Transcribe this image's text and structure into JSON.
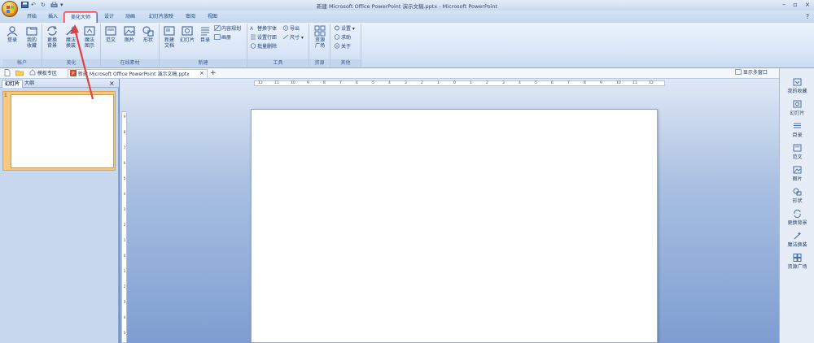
{
  "window": {
    "title": "新建 Microsoft Office PowerPoint 演示文稿.pptx - Microsoft PowerPoint"
  },
  "tabs": [
    {
      "label": "开始"
    },
    {
      "label": "插入"
    },
    {
      "label": "美化大师",
      "active": true
    },
    {
      "label": "设计"
    },
    {
      "label": "动画"
    },
    {
      "label": "幻灯片放映"
    },
    {
      "label": "审阅"
    },
    {
      "label": "视图"
    }
  ],
  "ribbon": {
    "account": {
      "label": "帐户",
      "login": "登录",
      "favorites": [
        "我的",
        "收藏"
      ]
    },
    "beautify": {
      "label": "美化",
      "bg": [
        "更换",
        "背景"
      ],
      "magic": [
        "魔法",
        "换装"
      ],
      "magic_show": [
        "魔法",
        "图示"
      ]
    },
    "online": {
      "label": "在线素材",
      "template": "范文",
      "image": "图片",
      "shape": "形状"
    },
    "create": {
      "label": "新建",
      "new_doc": [
        "新建",
        "文档"
      ],
      "slide": "幻灯片",
      "toc": "目录",
      "content_plan": "内容规划",
      "album": "画册"
    },
    "tools": {
      "label": "工具",
      "replace_font": "替换字体",
      "line_spacing": "设置行距",
      "batch_delete": "批量删除",
      "export": "导出",
      "dimension": "尺寸"
    },
    "resources": {
      "label": "资源",
      "resource_plaza": [
        "资源",
        "广场"
      ]
    },
    "other": {
      "label": "其他",
      "settings": "设置",
      "help": "求助",
      "about": "关于"
    }
  },
  "doc_tabs": {
    "template_zone": "模板专区",
    "document": "新建 Microsoft Office PowerPoint 演示文稿.pptx",
    "add": "+",
    "show_multi_window": "显示多窗口"
  },
  "left_panel": {
    "tabs": [
      "幻灯片",
      "大纲"
    ],
    "close": "×",
    "slide_number": "1"
  },
  "right_panel": {
    "items": [
      {
        "label": "我的收藏",
        "icon": "favorites-icon"
      },
      {
        "label": "幻灯片",
        "icon": "slide-icon"
      },
      {
        "label": "目录",
        "icon": "toc-icon"
      },
      {
        "label": "范文",
        "icon": "template-icon"
      },
      {
        "label": "图片",
        "icon": "image-icon"
      },
      {
        "label": "形状",
        "icon": "shape-icon"
      },
      {
        "label": "更换背景",
        "icon": "refresh-icon"
      },
      {
        "label": "魔法换装",
        "icon": "magic-icon"
      },
      {
        "label": "资源广场",
        "icon": "grid-icon"
      }
    ]
  },
  "colors": {
    "ribbon_bg": "#dbe7f7",
    "highlight": "#e0403f",
    "workspace": "#7e9ed1",
    "thumb_selected": "#f7c880"
  },
  "ruler": {
    "h_ticks": [
      "12",
      "11",
      "10",
      "9",
      "8",
      "7",
      "6",
      "5",
      "4",
      "3",
      "2",
      "1",
      "0",
      "1",
      "2",
      "3",
      "4",
      "5",
      "6",
      "7",
      "8",
      "9",
      "10",
      "11",
      "12"
    ],
    "v_ticks": [
      "9",
      "8",
      "7",
      "6",
      "5",
      "4",
      "3",
      "2",
      "1",
      "0",
      "1",
      "2",
      "3",
      "4",
      "5"
    ]
  }
}
